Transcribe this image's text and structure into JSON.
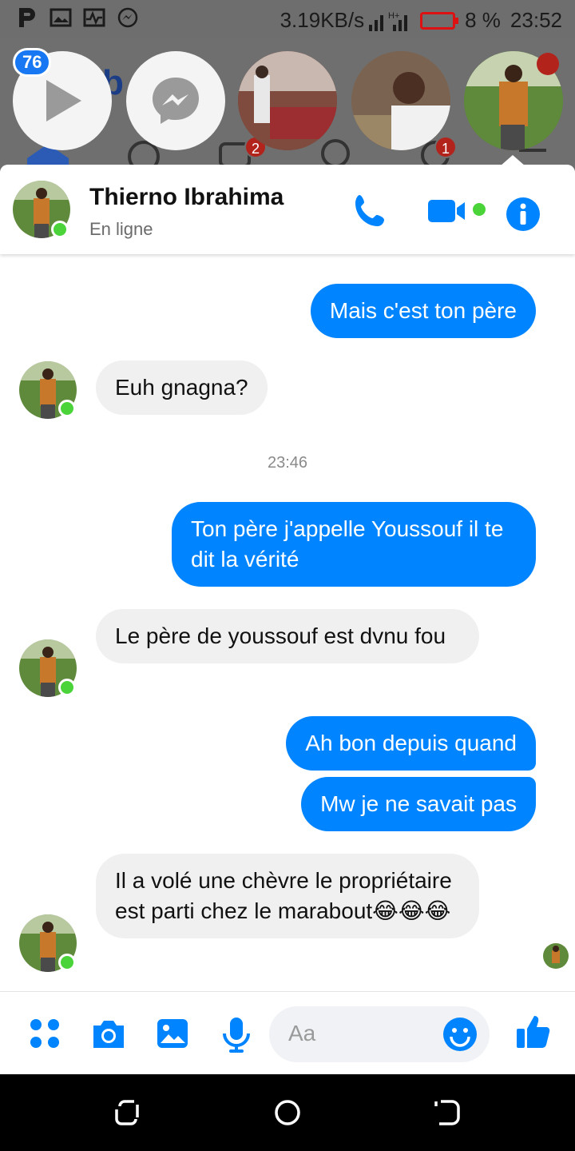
{
  "status_bar": {
    "speed": "3.19KB/s",
    "network": "H+",
    "battery": "8 %",
    "time": "23:52",
    "icons": [
      "p-icon",
      "image-icon",
      "pulse-icon",
      "messenger-status-icon",
      "signal-icon",
      "battery-icon"
    ]
  },
  "background_app": {
    "video_badge": "76",
    "tab_badge_1": "2",
    "tab_badge_2": "1"
  },
  "chat": {
    "contact_name": "Thierno Ibrahima",
    "contact_status": "En ligne",
    "accent": "#0084ff",
    "online_color": "#4bd33a",
    "messages": [
      {
        "dir": "out",
        "text": "Mais c'est ton père"
      },
      {
        "dir": "in",
        "text": "Euh gnagna?"
      },
      {
        "dir": "out",
        "text": "Ton père j'appelle Youssouf il te dit la vérité"
      },
      {
        "dir": "in",
        "text": "Le père de youssouf est dvnu fou"
      },
      {
        "dir": "out",
        "text": "Ah bon depuis quand"
      },
      {
        "dir": "out",
        "text": "Mw je ne savait pas"
      },
      {
        "dir": "in",
        "text": "Il a volé une chèvre le propriétaire est parti chez le marabout😂😂😂"
      }
    ],
    "timestamp": "23:46"
  },
  "composer": {
    "placeholder": "Aa",
    "icons": [
      "apps-icon",
      "camera-icon",
      "gallery-icon",
      "microphone-icon",
      "emoji-icon",
      "thumbs-up-icon"
    ]
  }
}
